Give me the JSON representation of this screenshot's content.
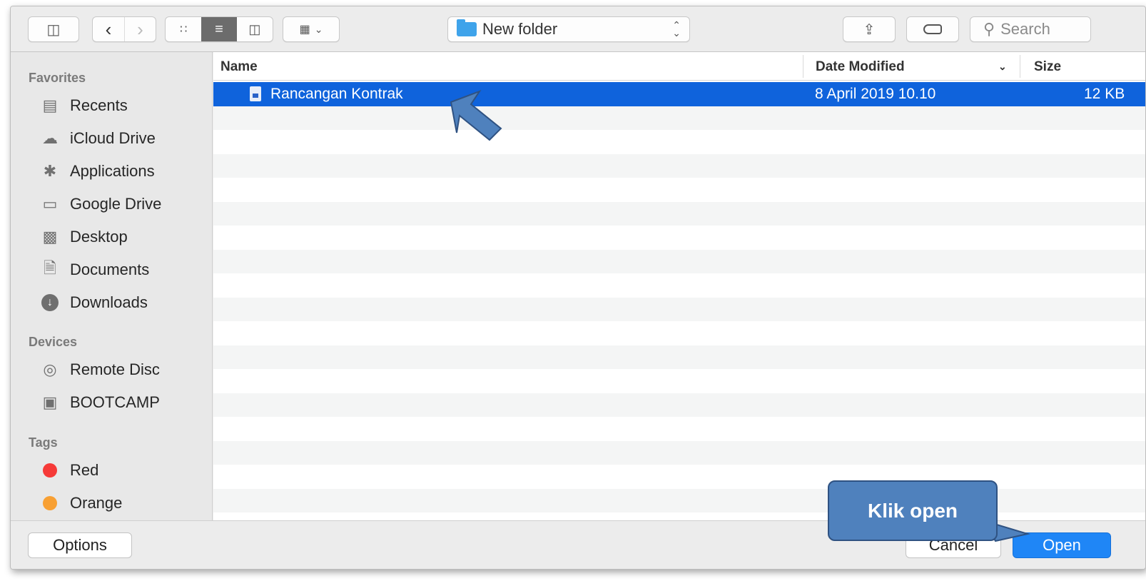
{
  "toolbar": {
    "path_label": "New folder",
    "search_placeholder": "Search"
  },
  "sidebar": {
    "favorites_title": "Favorites",
    "favorites": [
      {
        "label": "Recents",
        "icon": "recents-icon"
      },
      {
        "label": "iCloud Drive",
        "icon": "cloud-icon"
      },
      {
        "label": "Applications",
        "icon": "applications-icon"
      },
      {
        "label": "Google Drive",
        "icon": "folder-icon"
      },
      {
        "label": "Desktop",
        "icon": "desktop-icon"
      },
      {
        "label": "Documents",
        "icon": "documents-icon"
      },
      {
        "label": "Downloads",
        "icon": "downloads-icon"
      }
    ],
    "devices_title": "Devices",
    "devices": [
      {
        "label": "Remote Disc",
        "icon": "disc-icon"
      },
      {
        "label": "BOOTCAMP",
        "icon": "drive-icon"
      }
    ],
    "tags_title": "Tags",
    "tags": [
      {
        "label": "Red",
        "color": "#f63a38"
      },
      {
        "label": "Orange",
        "color": "#f8a033"
      }
    ]
  },
  "list": {
    "col_name": "Name",
    "col_date": "Date Modified",
    "col_size": "Size",
    "files": [
      {
        "name": "Rancangan Kontrak",
        "date": "8 April 2019 10.10",
        "size": "12 KB"
      }
    ]
  },
  "buttons": {
    "options": "Options",
    "cancel": "Cancel",
    "open": "Open"
  },
  "callout": {
    "text": "Klik open",
    "color": "#4f81bd"
  }
}
